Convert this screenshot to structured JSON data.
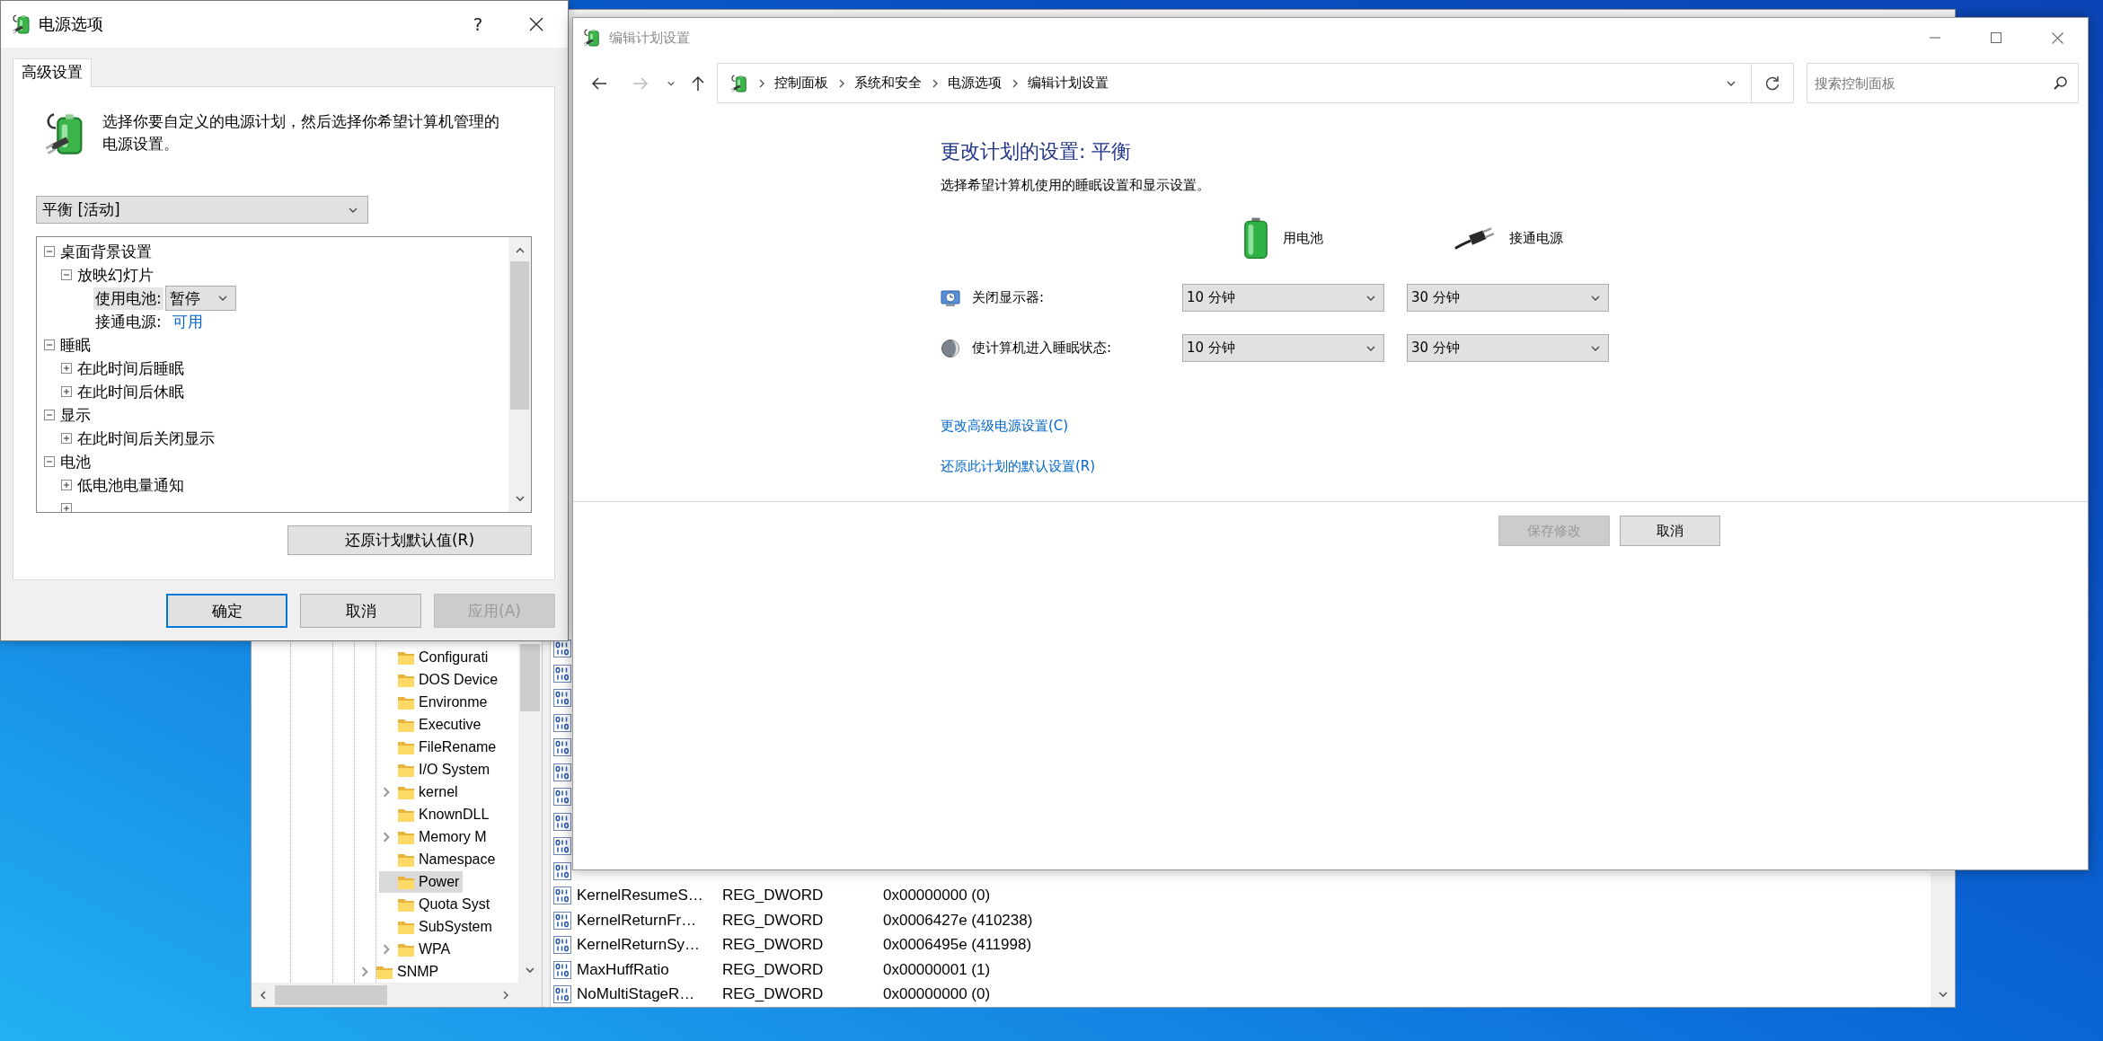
{
  "registry_editor": {
    "tree": [
      {
        "children": [
          {
            "label": "Configurati",
            "expandable": false,
            "selected": false
          },
          {
            "label": "DOS Device",
            "expandable": false,
            "selected": false
          },
          {
            "label": "Environme",
            "expandable": false,
            "selected": false
          },
          {
            "label": "Executive",
            "expandable": false,
            "selected": false
          },
          {
            "label": "FileRename",
            "expandable": false,
            "selected": false
          },
          {
            "label": "I/O System",
            "expandable": false,
            "selected": false
          },
          {
            "label": "kernel",
            "expandable": true,
            "selected": false
          },
          {
            "label": "KnownDLL",
            "expandable": false,
            "selected": false
          },
          {
            "label": "Memory M",
            "expandable": true,
            "selected": false
          },
          {
            "label": "Namespace",
            "expandable": false,
            "selected": false
          },
          {
            "label": "Power",
            "expandable": false,
            "selected": true
          },
          {
            "label": "Quota Syst",
            "expandable": false,
            "selected": false
          },
          {
            "label": "SubSystem",
            "expandable": false,
            "selected": false
          },
          {
            "label": "WPA",
            "expandable": true,
            "selected": false
          }
        ]
      },
      {
        "label": "SNMP",
        "expandable": true,
        "selected": false
      }
    ],
    "values": [
      {
        "kind": "dword"
      },
      {
        "kind": "dword"
      },
      {
        "kind": "dword"
      },
      {
        "kind": "dword"
      },
      {
        "kind": "dword"
      },
      {
        "kind": "dword"
      },
      {
        "kind": "dword"
      },
      {
        "kind": "dword"
      },
      {
        "kind": "dword"
      },
      {
        "kind": "dword"
      },
      {
        "kind": "dword",
        "name": "KernelResumeS…",
        "type": "REG_DWORD",
        "data": "0x00000000 (0)"
      },
      {
        "kind": "dword",
        "name": "KernelReturnFr…",
        "type": "REG_DWORD",
        "data": "0x0006427e (410238)"
      },
      {
        "kind": "dword",
        "name": "KernelReturnSy…",
        "type": "REG_DWORD",
        "data": "0x0006495e (411998)"
      },
      {
        "kind": "dword",
        "name": "MaxHuffRatio",
        "type": "REG_DWORD",
        "data": "0x00000001 (1)"
      },
      {
        "kind": "dword",
        "name": "NoMultiStageR…",
        "type": "REG_DWORD",
        "data": "0x00000000 (0)"
      }
    ]
  },
  "power_options_dialog": {
    "title": "电源选项",
    "help": "?",
    "tabs": [
      {
        "label": "高级设置",
        "selected": true
      }
    ],
    "description": "选择你要自定义的电源计划，然后选择你希望计算机管理的电源设置。",
    "plan_dropdown": {
      "value": "平衡 [活动]"
    },
    "settings_tree": [
      {
        "kind": "group",
        "label": "桌面背景设置",
        "expanded": true,
        "children": [
          {
            "kind": "group",
            "label": "放映幻灯片",
            "expanded": true,
            "children": [
              {
                "kind": "dropdown",
                "label": "使用电池:",
                "value": "暂停",
                "selected": true
              },
              {
                "kind": "link",
                "label": "接通电源:",
                "value": "可用",
                "selected": false
              }
            ]
          }
        ]
      },
      {
        "kind": "group",
        "label": "睡眠",
        "expanded": true,
        "children": [
          {
            "kind": "group",
            "label": "在此时间后睡眠",
            "expanded": false
          },
          {
            "kind": "group",
            "label": "在此时间后休眠",
            "expanded": false
          }
        ]
      },
      {
        "kind": "group",
        "label": "显示",
        "expanded": true,
        "children": [
          {
            "kind": "group",
            "label": "在此时间后关闭显示",
            "expanded": false
          }
        ]
      },
      {
        "kind": "group",
        "label": "电池",
        "expanded": true,
        "children": [
          {
            "kind": "group",
            "label": "低电池电量通知",
            "expanded": false
          },
          {
            "kind": "group",
            "expanded": false
          }
        ]
      }
    ],
    "restore_button": "还原计划默认值(R)",
    "buttons": [
      {
        "label": "确定",
        "default": true,
        "disabled": false
      },
      {
        "label": "取消",
        "default": false,
        "disabled": false
      },
      {
        "label": "应用(A)",
        "default": false,
        "disabled": true
      }
    ]
  },
  "edit_plan_window": {
    "title": "编辑计划设置",
    "breadcrumb": [
      "控制面板",
      "系统和安全",
      "电源选项",
      "编辑计划设置"
    ],
    "search": {
      "placeholder": "搜索控制面板"
    },
    "heading": "更改计划的设置: 平衡",
    "subtitle": "选择希望计算机使用的睡眠设置和显示设置。",
    "columns": [
      {
        "kind": "battery",
        "label": "用电池"
      },
      {
        "kind": "plug",
        "label": "接通电源"
      }
    ],
    "settings": [
      {
        "kind": "display",
        "label": "关闭显示器:",
        "values": [
          "10 分钟",
          "30 分钟"
        ]
      },
      {
        "kind": "sleep",
        "label": "使计算机进入睡眠状态:",
        "values": [
          "10 分钟",
          "30 分钟"
        ]
      }
    ],
    "links": [
      "更改高级电源设置(C)",
      "还原此计划的默认设置(R)"
    ],
    "buttons": [
      {
        "label": "保存修改",
        "disabled": true
      },
      {
        "label": "取消",
        "disabled": false
      }
    ]
  }
}
